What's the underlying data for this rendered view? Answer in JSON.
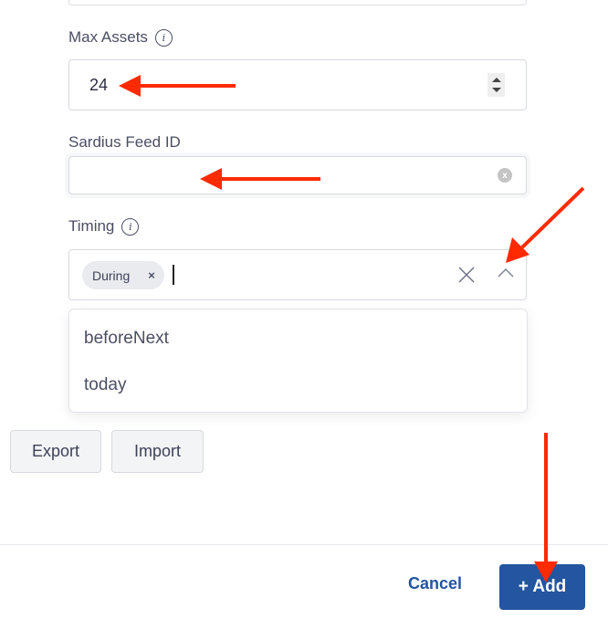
{
  "form": {
    "max_assets": {
      "label": "Max Assets",
      "info_icon": "info-icon",
      "value": "24",
      "stepper_icons": [
        "triangle-up-icon",
        "triangle-down-icon"
      ]
    },
    "sardius_feed_id": {
      "label": "Sardius Feed ID",
      "value": "",
      "clear_icon": "x"
    },
    "timing": {
      "label": "Timing",
      "info_icon": "info-icon",
      "selected_chips": [
        {
          "label": "During",
          "remove_icon": "×"
        }
      ],
      "clear_icon": "close-icon",
      "toggle_icon": "chevron-up-icon",
      "dropdown_open": true,
      "options": [
        "beforeNext",
        "today"
      ]
    }
  },
  "actions": {
    "export_label": "Export",
    "import_label": "Import"
  },
  "footer": {
    "cancel_label": "Cancel",
    "add_label": "+ Add"
  },
  "colors": {
    "primary": "#2355a0",
    "annotation_arrow": "#ff2a00",
    "chip_bg": "#e9ebef",
    "secondary_button_bg": "#f3f4f6"
  },
  "annotations": [
    {
      "type": "arrow",
      "points_to": "max-assets-input"
    },
    {
      "type": "arrow",
      "points_to": "sardius-feed-id-input"
    },
    {
      "type": "arrow",
      "points_to": "timing-dropdown-toggle"
    },
    {
      "type": "arrow",
      "points_to": "add-button"
    }
  ]
}
